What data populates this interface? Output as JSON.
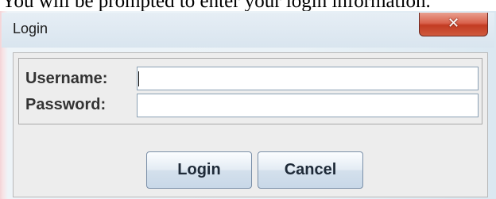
{
  "document": {
    "text": "You will be prompted to enter your login information."
  },
  "dialog": {
    "title": "Login",
    "close_icon": "close-icon",
    "fields": {
      "username_label": "Username:",
      "username_value": "",
      "password_label": "Password:",
      "password_value": ""
    },
    "buttons": {
      "login_label": "Login",
      "cancel_label": "Cancel"
    }
  },
  "colors": {
    "close_button": "#c23b22",
    "title_bar": "#dde7f0",
    "panel_background": "#ededed",
    "input_border": "#8aa0b4"
  }
}
